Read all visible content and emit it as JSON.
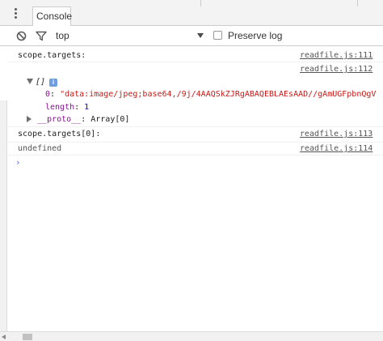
{
  "tabs": [
    {
      "label": "Console"
    }
  ],
  "toolbar": {
    "context": "top",
    "preserve_log_label": "Preserve log",
    "preserve_log_checked": false
  },
  "console": {
    "lines": [
      {
        "text": "scope.targets:",
        "source": "readfile.js:111"
      },
      {
        "source": "readfile.js:112"
      },
      {
        "text": "scope.targets[0]:",
        "source": "readfile.js:113"
      },
      {
        "text": "undefined",
        "source": "readfile.js:114"
      }
    ],
    "array_preview": "[]",
    "info_badge": "i",
    "array_props": [
      {
        "key": "0",
        "value": "\"data:image/jpeg;base64,/9j/4AAQSkZJRgABAQEBLAEsAAD//gAmUGFpbnQgV"
      },
      {
        "key": "length",
        "value": "1"
      },
      {
        "key": "__proto__",
        "value": "Array[0]"
      }
    ],
    "prompt": "›"
  },
  "colors": {
    "key": "#881391",
    "string": "#c41a16",
    "number": "#1c00cf",
    "prompt": "#367cf1",
    "info_badge": "#6e9de3"
  }
}
